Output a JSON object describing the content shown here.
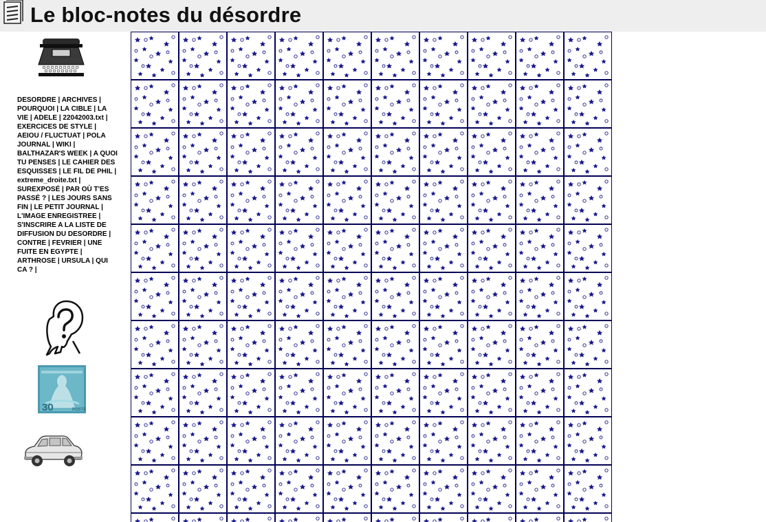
{
  "header": {
    "title": "Le bloc-notes du désordre",
    "icon": "notepad-icon"
  },
  "sidebar": {
    "nav_links": [
      "DESORDRE",
      "ARCHIVES",
      "POURQUOI",
      "LA CIBLE",
      "LA VIE",
      "ADELE",
      "22042003.txt",
      "EXERCICES DE STYLE",
      "AEIOU / FLUCTUAT",
      "POLA JOURNAL",
      "WIKI",
      "BALTHAZAR'S WEEK",
      "A QUOI TU PENSES",
      "LE CAHIER DES ESQUISSES",
      "LE FIL DE PHIL",
      "extreme_droite.txt",
      "SUREXPOSÉ",
      "PAR OÙ T'ES PASSÉ ?",
      "LES JOURS SANS FIN",
      "LE PETIT JOURNAL",
      "L'IMAGE ENREGISTREE",
      "S'INSCRIRE A LA LISTE DE DIFFUSION DU DESORDRE",
      "CONTRE",
      "FEVRIER",
      "UNE FUITE EN EGYPTE",
      "ARTHROSE",
      "URSULA",
      "QUI CA ?"
    ],
    "separator": "|",
    "images": [
      "typewriter-image",
      "question-mark-image",
      "stamp-image",
      "car-image"
    ]
  },
  "background": {
    "pattern": "blue-star-tile",
    "colors": {
      "star": "#1a1a8a",
      "grid": "#000055",
      "header_bg": "#eeeeee"
    }
  }
}
